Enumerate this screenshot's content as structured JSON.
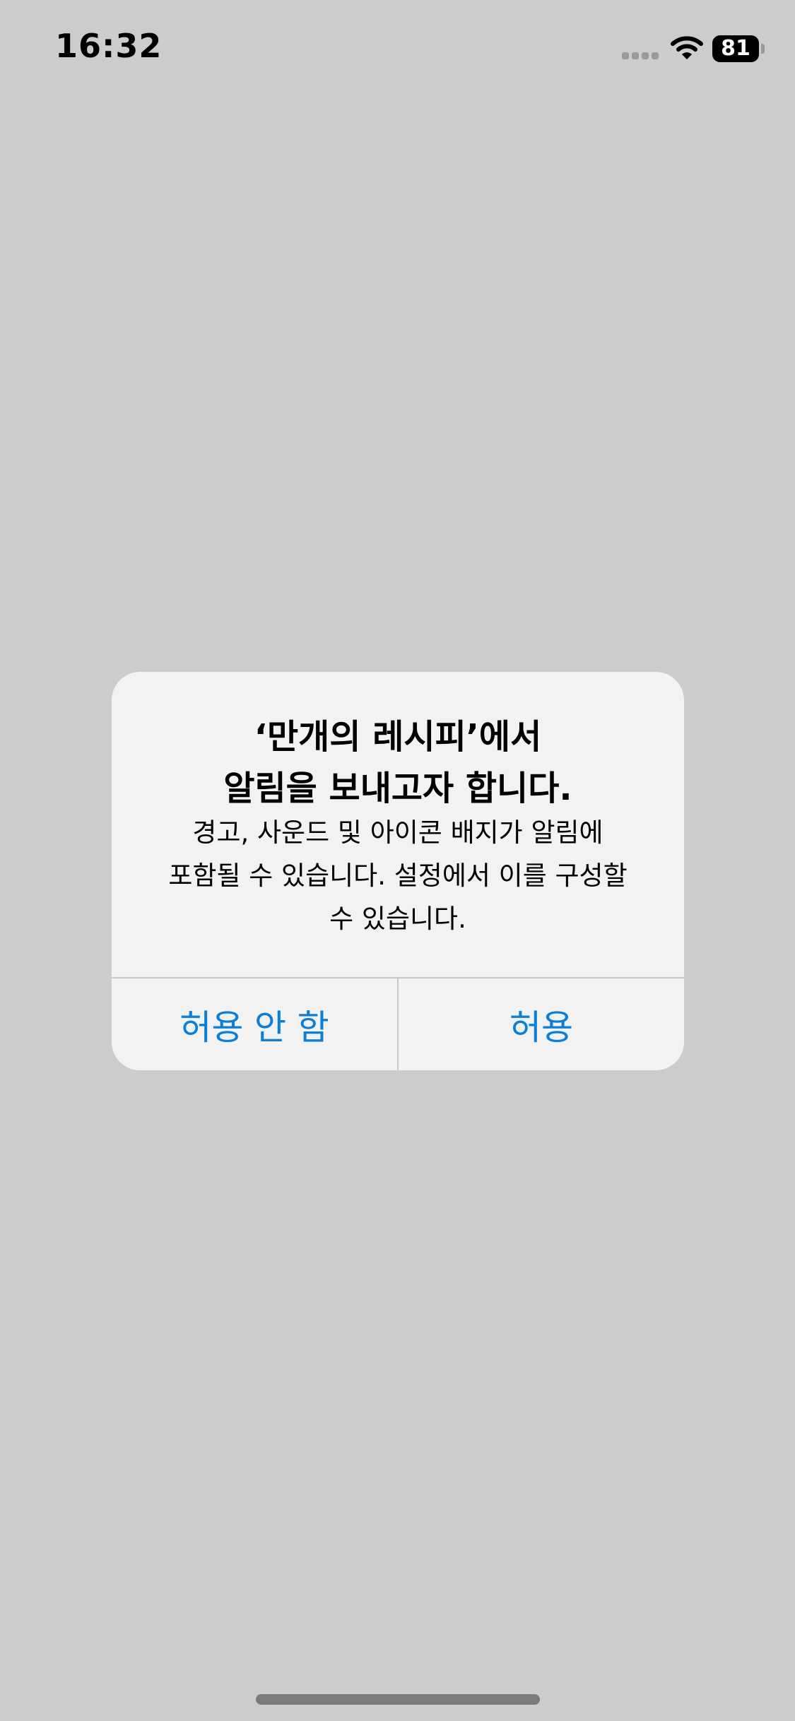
{
  "status_bar": {
    "time": "16:32",
    "battery_level": "81",
    "icons": [
      "cellular-signal-icon",
      "wifi-icon",
      "battery-icon"
    ]
  },
  "alert": {
    "title_line1": "‘만개의 레시피’에서",
    "title_line2": "알림을 보내고자 합니다.",
    "message_line1": "경고, 사운드 및 아이콘 배지가 알림에",
    "message_line2": "포함될 수 있습니다. 설정에서 이를 구성할",
    "message_line3": "수 있습니다.",
    "deny_label": "허용 안 함",
    "allow_label": "허용"
  },
  "colors": {
    "background": "#cccccc",
    "alert_background": "#f2f2f2",
    "button_text": "#0a7ed8",
    "divider": "#c8c8c8"
  }
}
